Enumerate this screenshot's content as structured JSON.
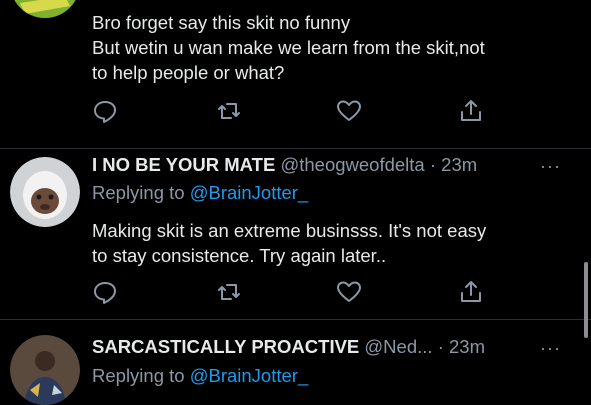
{
  "tweets": [
    {
      "text_lines": [
        "Bro forget say this skit no funny",
        "But wetin u wan make we learn from the skit,not",
        "to help people or what?"
      ]
    },
    {
      "name": "I NO BE YOUR MATE",
      "handle": "@theogweofdelta",
      "time": "· 23m",
      "more": "···",
      "replying_prefix": "Replying to",
      "replying_handle": "@BrainJotter_",
      "text_lines": [
        "Making skit is an extreme businsss. It's not easy",
        "to stay consistence. Try again later.."
      ]
    },
    {
      "name": "SARCASTICALLY PROACTIVE",
      "handle": "@Ned...",
      "time": "· 23m",
      "more": "···",
      "replying_prefix": "Replying to",
      "replying_handle": "@BrainJotter_"
    }
  ],
  "actions": [
    "reply-icon",
    "retweet-icon",
    "like-icon",
    "share-icon"
  ],
  "colors": {
    "accent": "#1d9bf0",
    "muted": "#8b98a5",
    "text": "#e7e9ea",
    "background": "#000000"
  }
}
